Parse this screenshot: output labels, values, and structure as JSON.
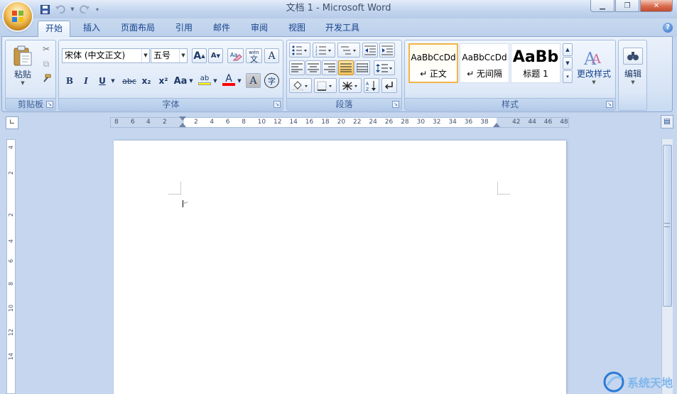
{
  "window": {
    "title": "文档 1 - Microsoft Word"
  },
  "qat": {
    "save_icon": "save-icon",
    "undo_icon": "undo-icon",
    "redo_icon": "redo-icon",
    "customize_icon": "customize-qat-icon"
  },
  "tabs": [
    {
      "label": "开始",
      "active": true
    },
    {
      "label": "插入"
    },
    {
      "label": "页面布局"
    },
    {
      "label": "引用"
    },
    {
      "label": "邮件"
    },
    {
      "label": "审阅"
    },
    {
      "label": "视图"
    },
    {
      "label": "开发工具"
    }
  ],
  "clipboard": {
    "paste_label": "粘贴",
    "group_label": "剪贴板"
  },
  "font": {
    "name_value": "宋体 (中文正文)",
    "size_value": "五号",
    "group_label": "字体",
    "grow": "A",
    "shrink": "A",
    "bold": "B",
    "italic": "I",
    "underline": "U",
    "strike": "abc",
    "subscript": "x₂",
    "superscript": "x²",
    "change_case": "Aa",
    "highlight": "ab",
    "font_color": "A",
    "char_shading": "A",
    "enclose": "字",
    "phonetic": "wén",
    "phonetic_base": "文"
  },
  "paragraph": {
    "group_label": "段落"
  },
  "styles": {
    "group_label": "样式",
    "items": [
      {
        "sample": "AaBbCcDd",
        "label": "↵ 正文"
      },
      {
        "sample": "AaBbCcDd",
        "label": "↵ 无间隔"
      },
      {
        "sample": "AaBb",
        "label": "标题 1"
      }
    ],
    "change_label": "更改样式"
  },
  "editing": {
    "label": "编辑"
  },
  "ruler": {
    "ticks": [
      "8",
      "6",
      "4",
      "2",
      "2",
      "4",
      "6",
      "8",
      "10",
      "12",
      "14",
      "16",
      "18",
      "20",
      "22",
      "24",
      "26",
      "28",
      "30",
      "32",
      "34",
      "36",
      "38",
      "42",
      "44",
      "46",
      "48"
    ]
  },
  "vruler": {
    "ticks": [
      "4",
      "2",
      "2",
      "4",
      "6",
      "8",
      "10",
      "12",
      "14"
    ]
  },
  "watermark": {
    "text": "系统天地"
  },
  "colors": {
    "accent": "#15428b",
    "ribbon_bg": "#dde8f7",
    "highlight_yellow": "#ffff00",
    "font_red": "#ff0000",
    "selected_style_border": "#f2b44a"
  }
}
